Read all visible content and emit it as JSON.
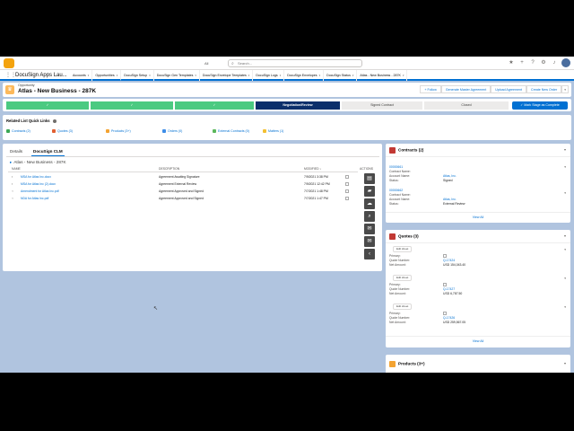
{
  "colors": {
    "brand": "#0070d2",
    "nav_bg": "#ffffff",
    "path_done": "#4bca81",
    "path_current": "#0b2f6b",
    "background": "#b0c4df"
  },
  "global": {
    "search_scope": "All",
    "search_placeholder": "Search..."
  },
  "nav": {
    "app_name": "DocuSign Apps Lau...",
    "tabs": [
      {
        "label": "Accounts"
      },
      {
        "label": "Opportunities",
        "active": true
      },
      {
        "label": "DocuSign Setup"
      },
      {
        "label": "DocuSign Gen Templates"
      },
      {
        "label": "DocuSign Envelope Templates"
      },
      {
        "label": "DocuSign Logs"
      },
      {
        "label": "DocuSign Envelopes"
      },
      {
        "label": "DocuSign Status"
      },
      {
        "label": "Atlas - New Business - 287K"
      }
    ]
  },
  "record": {
    "type": "Opportunity",
    "title": "Atlas - New Business - 287K",
    "actions": [
      "+ Follow",
      "Generate Master Agreement",
      "Upload Agreement",
      "Create New Order"
    ]
  },
  "path": {
    "stages": [
      {
        "label": "✓",
        "state": "done"
      },
      {
        "label": "✓",
        "state": "done"
      },
      {
        "label": "✓",
        "state": "done"
      },
      {
        "label": "Negotiation/Review",
        "state": "current"
      },
      {
        "label": "Signed Contract",
        "state": "todo"
      },
      {
        "label": "Closed",
        "state": "todo"
      }
    ],
    "mark_button": "✓ Mark Stage as Complete"
  },
  "quick_links": {
    "title": "Related List Quick Links",
    "items": [
      {
        "label": "Contracts (2)",
        "color": "#3ba755"
      },
      {
        "label": "Quotes (3)",
        "color": "#e16032"
      },
      {
        "label": "Products (3+)",
        "color": "#f3a332"
      },
      {
        "label": "Orders (0)",
        "color": "#3e8ee8"
      },
      {
        "label": "External Contracts (0)",
        "color": "#5cb85c"
      },
      {
        "label": "Matters (1)",
        "color": "#f3c033"
      }
    ]
  },
  "main": {
    "tabs": [
      {
        "label": "Details"
      },
      {
        "label": "DocuSign CLM",
        "active": true
      }
    ],
    "folder": "Atlas - New Business - 287K",
    "columns": {
      "name": "NAME",
      "description": "DESCRIPTION",
      "modified": "MODIFIED ↓",
      "actions": "ACTIONS"
    },
    "rows": [
      {
        "name": "MSA for Atlas Inc.docx",
        "description": "Agreement Awaiting Signature",
        "modified": "7/9/2021 3:38 PM"
      },
      {
        "name": "MSA for Atlas Inc (2).docx",
        "description": "Agreement External Review",
        "modified": "7/9/2021 12:42 PM"
      },
      {
        "name": "Amendment for Atlas Inc.pdf",
        "description": "Agreement Approved and Signed",
        "modified": "7/7/2021 1:48 PM"
      },
      {
        "name": "NDA for Atlas Inc.pdf",
        "description": "Agreement Approved and Signed",
        "modified": "7/7/2021 1:47 PM"
      }
    ]
  },
  "contracts": {
    "header": "Contracts (2)",
    "items": [
      {
        "number": "00000661",
        "name_label": "Contract Name:",
        "account_label": "Account Name:",
        "account": "Atlas, Inc.",
        "status_label": "Status:",
        "status": "Signed"
      },
      {
        "number": "00000662",
        "name_label": "Contract Name:",
        "account_label": "Account Name:",
        "account": "Atlas, Inc.",
        "status_label": "Status:",
        "status": "External Review"
      }
    ],
    "view_all": "View All"
  },
  "quotes": {
    "header": "Quotes (3)",
    "edit_label": "Edit sheet",
    "items": [
      {
        "primary_label": "Primary:",
        "quote_label": "Quote Number:",
        "quote": "Q-17424",
        "net_label": "Net Amount:",
        "net": "USD 154,043.40"
      },
      {
        "primary_label": "Primary:",
        "quote_label": "Quote Number:",
        "quote": "Q-17427",
        "net_label": "Net Amount:",
        "net": "USD 6,787.50"
      },
      {
        "primary_label": "Primary:",
        "quote_label": "Quote Number:",
        "quote": "Q-17426",
        "net_label": "Net Amount:",
        "net": "USD 259,567.05"
      }
    ],
    "view_all": "View All"
  },
  "products": {
    "header": "Products (3+)"
  }
}
